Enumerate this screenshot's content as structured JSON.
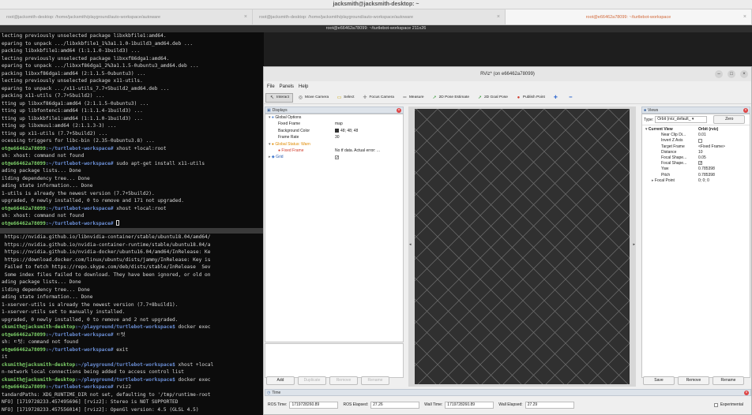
{
  "window_title": "jacksmith@jacksmith-desktop: ~",
  "tabs": [
    {
      "label": "root@jacksmith-desktop: /home/jacksmith/playground/auto-workspace/autoware",
      "active": false
    },
    {
      "label": "root@jacksmith-desktop: /home/jacksmith/playground/auto-workspace/autoware",
      "active": false
    },
    {
      "label": "root@e66462a78099: ~/turtlebot-workspace",
      "active": true
    }
  ],
  "terminal_subtitle": "root@e66462a78099: ~/turtlebot-workspace 211x26",
  "term_top_lines": [
    "lecting previously unselected package libxkbfile1:amd64.",
    "eparing to unpack .../libxkbfile1_1%3a1.1.0-1build3_amd64.deb ...",
    "packing libxkbfile1:amd64 (1:1.1.0-1build3) ...",
    "lecting previously unselected package libxxf86dga1:amd64.",
    "eparing to unpack .../libxxf86dga1_2%3a1.1.5-0ubuntu3_amd64.deb ...",
    "packing libxxf86dga1:amd64 (2:1.1.5-0ubuntu3) ...",
    "lecting previously unselected package x11-utils.",
    "eparing to unpack .../x11-utils_7.7+5build2_amd64.deb ...",
    "packing x11-utils (7.7+5build2) ...",
    "tting up libxxf86dga1:amd64 (2:1.1.5-0ubuntu3) ...",
    "tting up libfontenc1:amd64 (1:1.1.4-1build3) ...",
    "tting up libxkbfile1:amd64 (1:1.1.0-1build3) ...",
    "tting up libxmuu1:amd64 (2:1.1.3-3) ...",
    "tting up x11-utils (7.7+5build2) ...",
    "ocessing triggers for libc-bin (2.35-0ubuntu3.8) ..."
  ],
  "term_top_prompts": [
    {
      "user": "ot@e66462a78099",
      "path": ":~/turtlebot-workspace#",
      "cmd": " xhost +local:root"
    },
    {
      "text": "sh: xhost: command not found"
    },
    {
      "user": "ot@e66462a78099",
      "path": ":~/turtlebot-workspace#",
      "cmd": " sudo apt-get install x11-utils"
    },
    {
      "text": "ading package lists... Done"
    },
    {
      "text": "ilding dependency tree... Done"
    },
    {
      "text": "ading state information... Done"
    },
    {
      "text": "1-utils is already the newest version (7.7+5build2)."
    },
    {
      "text": "upgraded, 0 newly installed, 0 to remove and 171 not upgraded."
    },
    {
      "user": "ot@e66462a78099",
      "path": ":~/turtlebot-workspace#",
      "cmd": " xhost +local:root"
    },
    {
      "text": "sh: xhost: command not found"
    },
    {
      "user": "ot@e66462a78099",
      "path": ":~/turtlebot-workspace#",
      "cmd": " ",
      "cursor": true
    }
  ],
  "term_bottom_lines": [
    {
      "text": " https://nvidia.github.io/libnvidia-container/stable/ubuntu18.04/amd64/"
    },
    {
      "text": " https://nvidia.github.io/nvidia-container-runtime/stable/ubuntu18.04/a"
    },
    {
      "text": " https://nvidia.github.io/nvidia-docker/ubuntu16.04/amd64/InRelease: Ke"
    },
    {
      "text": " https://download.docker.com/linux/ubuntu/dists/jammy/InRelease: Key is"
    },
    {
      "text": " Failed to fetch https://repo.skype.com/deb/dists/stable/InRelease  Sev"
    },
    {
      "text": " Some index files failed to download. They have been ignored, or old on"
    },
    {
      "text": "ading package lists... Done"
    },
    {
      "text": "ilding dependency tree... Done"
    },
    {
      "text": "ading state information... Done"
    },
    {
      "text": "1-xserver-utils is already the newest version (7.7+8build1)."
    },
    {
      "text": "1-xserver-utils set to manually installed."
    },
    {
      "text": "upgraded, 0 newly installed, 0 to remove and 2 not upgraded."
    },
    {
      "user": "cksmith@jacksmith-desktop",
      "path": ":~/playground/turtlebot-workspace$",
      "cmd": " docker exec"
    },
    {
      "user": "ot@e66462a78099",
      "path": ":~/turtlebot-workspace#",
      "cmd": " ㄷ텃"
    },
    {
      "text": "sh: ㄷ텃: command not found"
    },
    {
      "user": "ot@e66462a78099",
      "path": ":~/turtlebot-workspace#",
      "cmd": " exit"
    },
    {
      "text": "it"
    },
    {
      "user": "cksmith@jacksmith-desktop",
      "path": ":~/playground/turtlebot-workspace$",
      "cmd": " xhost +local"
    },
    {
      "text": "n-network local connections being added to access control list"
    },
    {
      "user": "cksmith@jacksmith-desktop",
      "path": ":~/playground/turtlebot-workspace$",
      "cmd": " docker exec"
    },
    {
      "user": "ot@e66462a78099",
      "path": ":~/turtlebot-workspace#",
      "cmd": " rviz2"
    },
    {
      "text": "tandardPaths: XDG_RUNTIME_DIR not set, defaulting to '/tmp/runtime-root"
    },
    {
      "text": "NFO] [1719728233.457495696] [rviz2]: Stereo is NOT SUPPORTED"
    },
    {
      "text": "NFO] [1719728233.457556014] [rviz2]: OpenGl version: 4.5 (GLSL 4.5)"
    }
  ],
  "rviz": {
    "title": "RViz* (on e66462a78099)",
    "window_buttons": [
      "–",
      "□",
      "×"
    ],
    "menu": [
      "File",
      "Panels",
      "Help"
    ],
    "tools": [
      {
        "label": "Interact",
        "icon": "cursor-icon",
        "glyph": "↖",
        "active": true,
        "color": "#333333"
      },
      {
        "label": "Move Camera",
        "icon": "camera-icon",
        "glyph": "◎",
        "active": false,
        "color": "#555555"
      },
      {
        "label": "Select",
        "icon": "select-icon",
        "glyph": "▭",
        "active": false,
        "color": "#c8a000"
      },
      {
        "label": "Focus Camera",
        "icon": "focus-icon",
        "glyph": "✛",
        "active": false,
        "color": "#555555"
      },
      {
        "label": "Measure",
        "icon": "ruler-icon",
        "glyph": "═",
        "active": false,
        "color": "#555555"
      },
      {
        "label": "2D Pose Estimate",
        "icon": "pose-estimate-icon",
        "glyph": "➚",
        "active": false,
        "color": "#3a9a3a"
      },
      {
        "label": "2D Goal Pose",
        "icon": "goal-pose-icon",
        "glyph": "➚",
        "active": false,
        "color": "#3a9a3a"
      },
      {
        "label": "Publish Point",
        "icon": "map-pin-icon",
        "glyph": "●",
        "active": false,
        "color": "#d03a2a"
      },
      {
        "label": "",
        "icon": "add-tool-icon",
        "glyph": "✚",
        "active": false,
        "color": "#3a6fd0"
      },
      {
        "label": "",
        "icon": "remove-tool-icon",
        "glyph": "━",
        "active": false,
        "color": "#3a6fd0"
      }
    ],
    "displays": {
      "header": "Displays",
      "rows": [
        {
          "indent": 0,
          "arrow": "▾",
          "icon": "●",
          "icon_color": "#4a7fd0",
          "label": "Global Options",
          "value": "",
          "cls": ""
        },
        {
          "indent": 1,
          "arrow": "",
          "icon": "",
          "label": "Fixed Frame",
          "value": "map",
          "cls": ""
        },
        {
          "indent": 1,
          "arrow": "",
          "icon": "",
          "label": "Background Color",
          "value": "48; 48; 48",
          "swatch": true,
          "cls": ""
        },
        {
          "indent": 1,
          "arrow": "",
          "icon": "",
          "label": "Frame Rate",
          "value": "30",
          "cls": ""
        },
        {
          "indent": 0,
          "arrow": "▾",
          "icon": "●",
          "icon_color": "#e08a00",
          "label": "Global Status: Warn",
          "value": "",
          "cls": "warn"
        },
        {
          "indent": 1,
          "arrow": "",
          "icon": "●",
          "icon_color": "#d03a2a",
          "label": "Fixed Frame",
          "value": "No tf data.  Actual error: ...",
          "cls": "err"
        },
        {
          "indent": 0,
          "arrow": "▸",
          "icon": "◆",
          "icon_color": "#4a7fd0",
          "label": "Grid",
          "value": "",
          "check": "✓",
          "cls": "link"
        }
      ],
      "buttons": [
        "Add",
        "Duplicate",
        "Remove",
        "Rename"
      ]
    },
    "views": {
      "header": "Views",
      "type_label": "Type:",
      "type_value": "Orbit (rviz_default_",
      "zero_button": "Zero",
      "rows": [
        {
          "arrow": "▾",
          "label": "Current View",
          "value": "Orbit (rviz)",
          "bold": true
        },
        {
          "arrow": "",
          "label": "Near Clip Di...",
          "value": "0.01"
        },
        {
          "arrow": "",
          "label": "Invert Z Axis",
          "value": "",
          "check": " "
        },
        {
          "arrow": "",
          "label": "Target Frame",
          "value": "<Fixed Frame>"
        },
        {
          "arrow": "",
          "label": "Distance",
          "value": "10"
        },
        {
          "arrow": "",
          "label": "Focal Shape...",
          "value": "0.05"
        },
        {
          "arrow": "",
          "label": "Focal Shape...",
          "value": "",
          "check": "✓"
        },
        {
          "arrow": "",
          "label": "Yaw",
          "value": "0.785398"
        },
        {
          "arrow": "",
          "label": "Pitch",
          "value": "0.785398"
        },
        {
          "arrow": "▸",
          "label": "Focal Point",
          "value": "0; 0; 0"
        }
      ],
      "buttons": [
        "Save",
        "Remove",
        "Rename"
      ]
    },
    "time": {
      "header": "Time",
      "ros_time_label": "ROS Time:",
      "ros_time": "1719728260.89",
      "ros_elapsed_label": "ROS Elapsed:",
      "ros_elapsed": "27.26",
      "wall_time_label": "Wall Time:",
      "wall_time": "1719728260.89",
      "wall_elapsed_label": "Wall Elapsed:",
      "wall_elapsed": "27.29",
      "experimental_label": "Experimental"
    }
  },
  "colors": {
    "viewport_background": "#303030",
    "grid_line": "#6e6e6e",
    "accent_tab": "#d2693a",
    "prompt_user": "#7fd26b",
    "prompt_path": "#6b8fd6"
  }
}
